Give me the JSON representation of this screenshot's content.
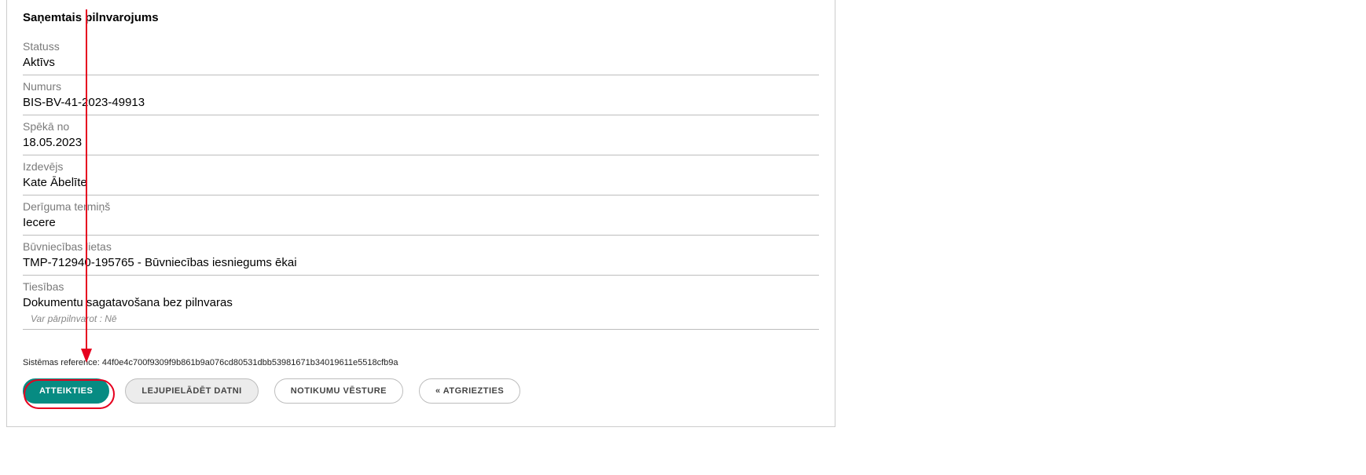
{
  "title": "Saņemtais pilnvarojums",
  "fields": {
    "status": {
      "label": "Statuss",
      "value": "Aktīvs"
    },
    "number": {
      "label": "Numurs",
      "value": "BIS-BV-41-2023-49913"
    },
    "valid_from": {
      "label": "Spēkā no",
      "value": "18.05.2023"
    },
    "issuer": {
      "label": "Izdevējs",
      "value": "Kate Ābelīte"
    },
    "validity": {
      "label": "Derīguma termiņš",
      "value": "Iecere"
    },
    "cases": {
      "label": "Būvniecības lietas",
      "value": "TMP-712940-195765 - Būvniecības iesniegums ēkai"
    },
    "rights": {
      "label": "Tiesības",
      "value": "Dokumentu sagatavošana bez pilnvaras",
      "sub": "Var pārpilnvarot : Nē"
    }
  },
  "sysref": {
    "label": "Sistēmas reference:",
    "value": "44f0e4c700f9309f9b861b9a076cd80531dbb53981671b34019611e5518cfb9a"
  },
  "buttons": {
    "decline": "Atteikties",
    "download": "Lejupielādēt datni",
    "history": "Notikumu vēsture",
    "back": "« Atgriezties"
  }
}
